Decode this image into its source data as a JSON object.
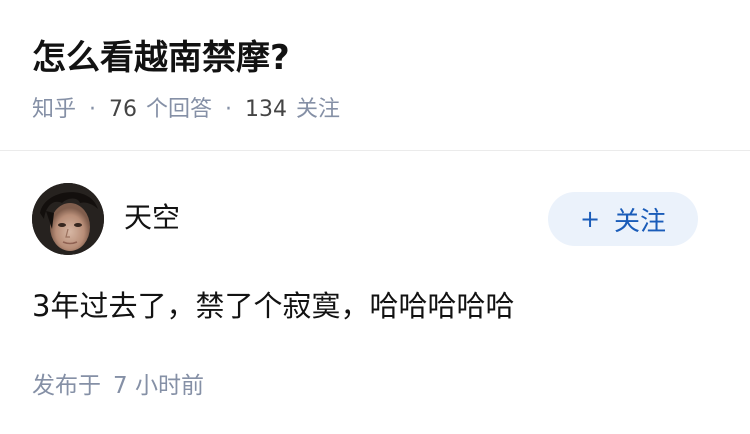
{
  "question": {
    "title": "怎么看越南禁摩?",
    "source": "知乎",
    "answer_count": "76",
    "answer_label": "个回答",
    "follower_count": "134",
    "follower_label": "关注"
  },
  "answer": {
    "author_name": "天空",
    "avatar_icon": "user-avatar-photo",
    "follow_button": {
      "icon": "plus-icon",
      "icon_glyph": "+",
      "label": "关注"
    },
    "content": "3年过去了，禁了个寂寞，哈哈哈哈哈",
    "publish_prefix": "发布于",
    "publish_time": "7 小时前"
  },
  "colors": {
    "meta_gray": "#8590a6",
    "follow_bg": "#ebf2fb",
    "follow_text": "#1a5cb9",
    "title_text": "#121212"
  }
}
